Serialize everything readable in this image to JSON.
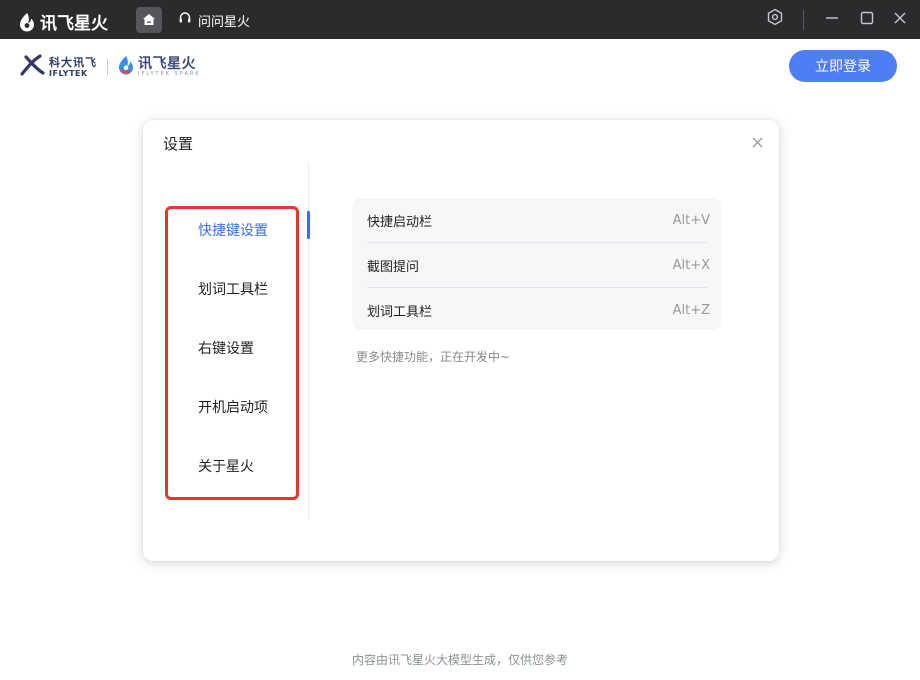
{
  "titlebar": {
    "app_name": "讯飞星火",
    "chat_tab_label": "问问星火"
  },
  "header": {
    "iflytek_cn": "科大讯飞",
    "iflytek_en": "IFLYTEK",
    "spark_cn": "讯飞星火",
    "spark_en": "IFLYTEK SPARK",
    "login_label": "立即登录"
  },
  "dialog": {
    "title": "设置",
    "nav": [
      {
        "label": "快捷键设置",
        "active": true
      },
      {
        "label": "划词工具栏",
        "active": false
      },
      {
        "label": "右键设置",
        "active": false
      },
      {
        "label": "开机启动项",
        "active": false
      },
      {
        "label": "关于星火",
        "active": false
      }
    ],
    "shortcuts": [
      {
        "name": "快捷启动栏",
        "key": "Alt+V"
      },
      {
        "name": "截图提问",
        "key": "Alt+X"
      },
      {
        "name": "划词工具栏",
        "key": "Alt+Z"
      }
    ],
    "more_note": "更多快捷功能，正在开发中~"
  },
  "footer": {
    "note": "内容由讯飞星火大模型生成，仅供您参考"
  },
  "colors": {
    "titlebar_bg": "#2b2b2e",
    "accent": "#3d6df2",
    "login_button": "#4f7df6",
    "highlight_border": "#e2372b"
  },
  "icons": [
    "spark-logo-icon",
    "home-icon",
    "headset-icon",
    "settings-icon",
    "minimize-icon",
    "maximize-icon",
    "close-icon",
    "iflytek-x-icon",
    "spark-drop-icon",
    "dialog-close-icon"
  ]
}
